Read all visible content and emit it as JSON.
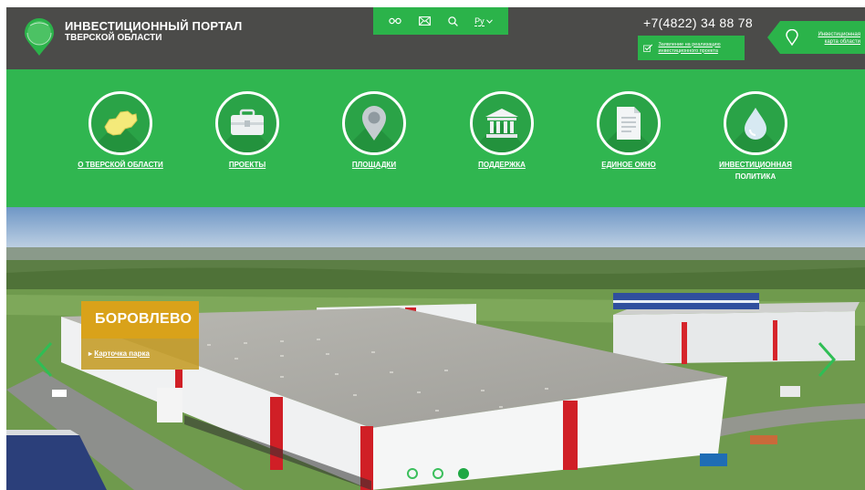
{
  "header": {
    "logo_line1": "ИНВЕСТИЦИОННЫЙ ПОРТАЛ",
    "logo_line2": "ТВЕРСКОЙ ОБЛАСТИ",
    "phone": "+7(4822) 34 88 78",
    "report_label": "Заявление на реализацию инвестиционного проекта",
    "map_label": "Инвестиционная карта области",
    "lang": "Ру"
  },
  "toolbar": {
    "icons": [
      "glasses-icon",
      "mail-icon",
      "search-icon",
      "language-select"
    ]
  },
  "nav": [
    {
      "label": "О ТВЕРСКОЙ ОБЛАСТИ",
      "icon": "region-map-icon"
    },
    {
      "label": "ПРОЕКТЫ",
      "icon": "briefcase-icon"
    },
    {
      "label": "ПЛОЩАДКИ",
      "icon": "location-pin-icon"
    },
    {
      "label": "ПОДДЕРЖКА",
      "icon": "bank-building-icon"
    },
    {
      "label": "ЕДИНОЕ ОКНО",
      "icon": "document-icon"
    },
    {
      "label": "ИНВЕСТИЦИОННАЯ",
      "label2": "ПОЛИТИКА",
      "icon": "drop-icon"
    }
  ],
  "slider": {
    "title": "БОРОВЛЕВО",
    "link": "Карточка парка",
    "slides": 3,
    "active_slide": 3
  },
  "colors": {
    "brand_green": "#30b650",
    "header_gray": "#4b4b49",
    "caption_gold": "#d9a21a"
  }
}
